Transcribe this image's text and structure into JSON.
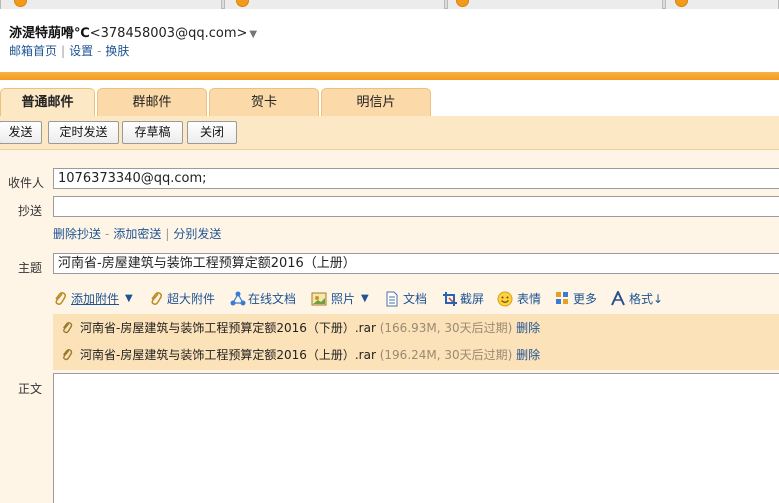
{
  "account": {
    "nickname": "洂湜特萠嗗℃",
    "email": "<378458003@qq.com>",
    "links": [
      "邮箱首页",
      "设置",
      "换肤"
    ]
  },
  "compose_tabs": [
    "普通邮件",
    "群邮件",
    "贺卡",
    "明信片"
  ],
  "toolbar": {
    "send": "发送",
    "scheduled_send": "定时发送",
    "save_draft": "存草稿",
    "close": "关闭"
  },
  "form": {
    "to_label": "收件人",
    "to_value": "1076373340@qq.com;",
    "cc_label": "抄送",
    "cc_value": "",
    "cc_links": [
      "删除抄送",
      "添加密送",
      "分别发送"
    ],
    "subject_label": "主题",
    "subject_value": "河南省-房屋建筑与装饰工程预算定额2016（上册）",
    "body_label": "正文"
  },
  "attach_toolbar": {
    "add_attachment": "添加附件",
    "large_attachment": "超大附件",
    "online_doc": "在线文档",
    "photo": "照片",
    "document": "文档",
    "screenshot": "截屏",
    "emoji": "表情",
    "more": "更多",
    "format": "格式↓"
  },
  "attachments": [
    {
      "name": "河南省-房屋建筑与装饰工程预算定额2016（下册）.rar",
      "meta": "(166.93M, 30天后过期)",
      "delete": "删除"
    },
    {
      "name": "河南省-房屋建筑与装饰工程预算定额2016（上册）.rar",
      "meta": "(196.24M, 30天后过期)",
      "delete": "删除"
    }
  ],
  "colors": {
    "accent": "#f39a1c",
    "panel": "#fde8c6",
    "link": "#1e5494"
  }
}
